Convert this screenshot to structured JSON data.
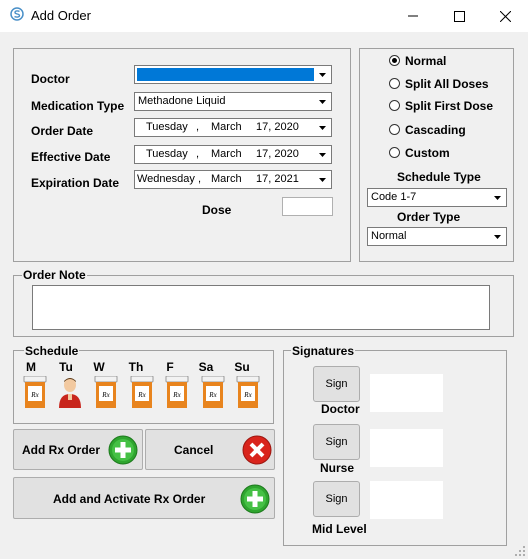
{
  "window": {
    "title": "Add Order"
  },
  "form": {
    "doctor_label": "Doctor",
    "doctor_value": "",
    "medication_type_label": "Medication Type",
    "medication_type_value": "Methadone Liquid",
    "order_date_label": "Order Date",
    "order_date": {
      "weekday": "Tuesday",
      "month": "March",
      "day_year": "17, 2020"
    },
    "effective_date_label": "Effective Date",
    "effective_date": {
      "weekday": "Tuesday",
      "month": "March",
      "day_year": "17, 2020"
    },
    "expiration_date_label": "Expiration Date",
    "expiration_date": {
      "weekday": "Wednesday",
      "month": "March",
      "day_year": "17, 2021"
    },
    "dose_label": "Dose",
    "dose_value": ""
  },
  "options": {
    "radios": [
      {
        "label": "Normal",
        "selected": true
      },
      {
        "label": "Split All Doses",
        "selected": false
      },
      {
        "label": "Split First Dose",
        "selected": false
      },
      {
        "label": "Cascading",
        "selected": false
      },
      {
        "label": "Custom",
        "selected": false
      }
    ],
    "schedule_type_label": "Schedule Type",
    "schedule_type_value": "Code 1-7",
    "order_type_label": "Order Type",
    "order_type_value": "Normal"
  },
  "order_note": {
    "label": "Order Note",
    "value": ""
  },
  "schedule": {
    "label": "Schedule",
    "days": [
      {
        "label": "M",
        "icon": "rx-bottle-icon"
      },
      {
        "label": "Tu",
        "icon": "person-icon"
      },
      {
        "label": "W",
        "icon": "rx-bottle-icon"
      },
      {
        "label": "Th",
        "icon": "rx-bottle-icon"
      },
      {
        "label": "F",
        "icon": "rx-bottle-icon"
      },
      {
        "label": "Sa",
        "icon": "rx-bottle-icon"
      },
      {
        "label": "Su",
        "icon": "rx-bottle-icon"
      }
    ],
    "rx_text": "Rx"
  },
  "buttons": {
    "add_rx_order": "Add Rx Order",
    "cancel": "Cancel",
    "add_activate": "Add and Activate Rx Order"
  },
  "signatures": {
    "label": "Signatures",
    "sign_text": "Sign",
    "roles": [
      "Doctor",
      "Nurse",
      "Mid Level"
    ]
  },
  "colors": {
    "selection_blue": "#0078d7",
    "plus_green": "#2fa52f",
    "cancel_red": "#d9241c",
    "bottle_orange": "#e8841e"
  }
}
